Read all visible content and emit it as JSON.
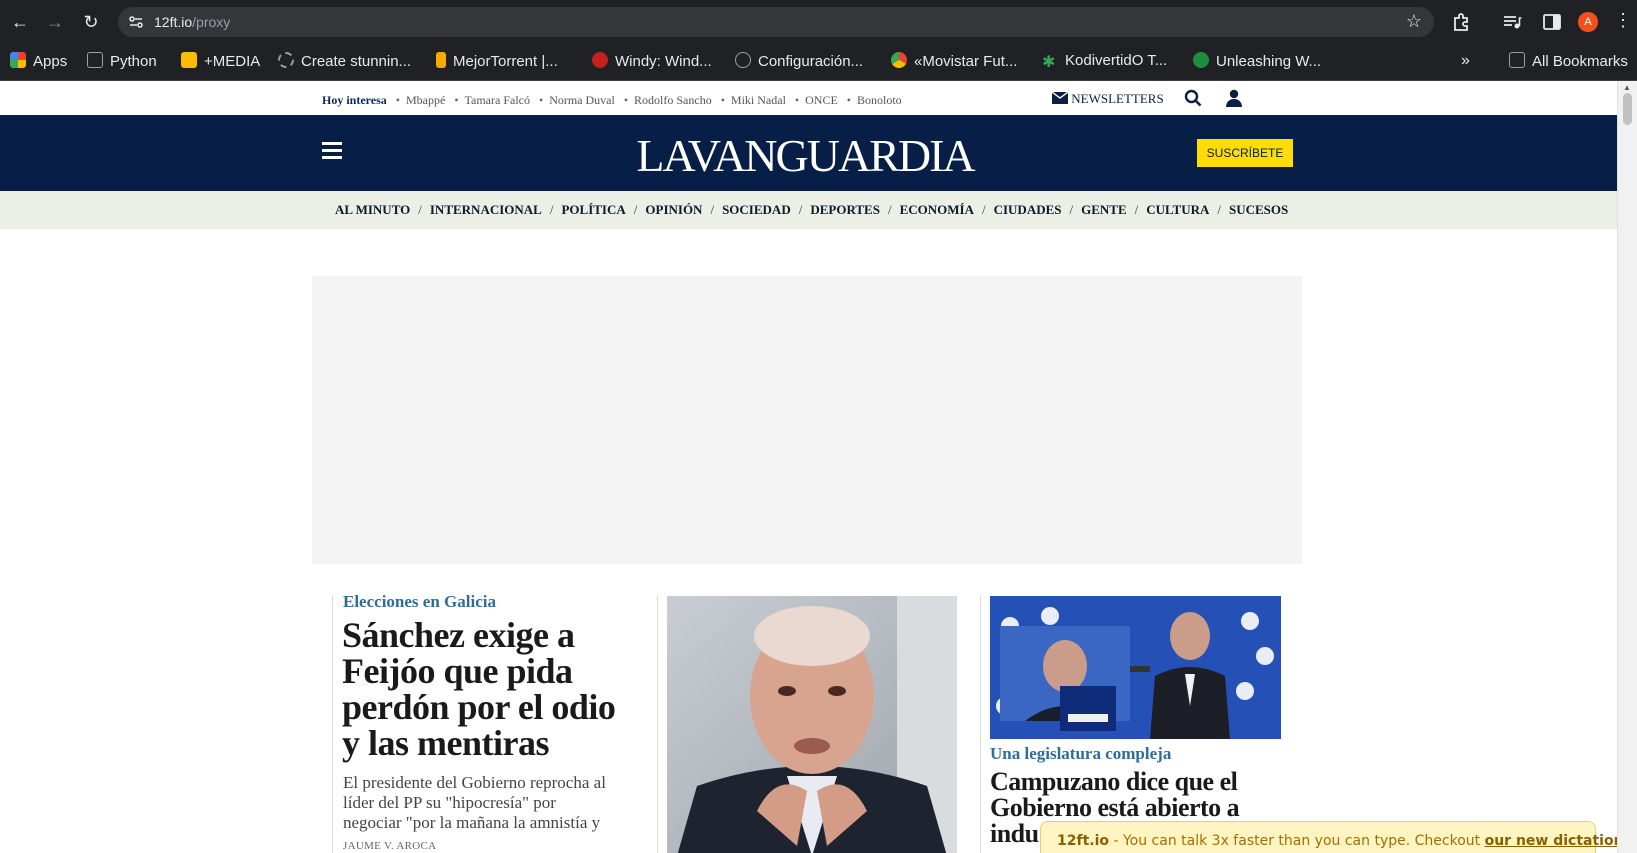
{
  "browser": {
    "url_host": "12ft.io",
    "url_path": "/proxy",
    "avatar_letter": "A",
    "bookmarks": [
      {
        "label": "Apps",
        "icon": "apps-grid-icon",
        "color": "#e8453c"
      },
      {
        "label": "Python",
        "icon": "folder-icon",
        "color": "#9aa0a6"
      },
      {
        "label": "+MEDIA",
        "icon": "plus-media-icon",
        "color": "#fbbc04"
      },
      {
        "label": "Create stunnin...",
        "icon": "spinner-icon",
        "color": "#9aa0a6"
      },
      {
        "label": "MejorTorrent |...",
        "icon": "torrent-icon",
        "color": "#f9ab00"
      },
      {
        "label": "Windy: Wind...",
        "icon": "windy-icon",
        "color": "#c5221f"
      },
      {
        "label": "Configuración...",
        "icon": "gear-globe-icon",
        "color": "#9aa0a6"
      },
      {
        "label": "«Movistar Fut...",
        "icon": "chrome-icon",
        "color": "#34a853"
      },
      {
        "label": "KodivertidO T...",
        "icon": "kodi-star-icon",
        "color": "#34a853"
      },
      {
        "label": "Unleashing W...",
        "icon": "leaf-icon",
        "color": "#1e8e3e"
      }
    ],
    "all_bookmarks": "All Bookmarks"
  },
  "site": {
    "hoy_label": "Hoy interesa",
    "trending": [
      "Mbappé",
      "Tamara Falcó",
      "Norma Duval",
      "Rodolfo Sancho",
      "Miki Nadal",
      "ONCE",
      "Bonoloto"
    ],
    "newsletters": "NEWSLETTERS",
    "logo": "LAVANGUARDIA",
    "subscribe": "SUSCRÍBETE",
    "sections": [
      "AL MINUTO",
      "INTERNACIONAL",
      "POLÍTICA",
      "OPINIÓN",
      "SOCIEDAD",
      "DEPORTES",
      "ECONOMÍA",
      "CIUDADES",
      "GENTE",
      "CULTURA",
      "SUCESOS"
    ],
    "colors": {
      "masthead": "#071e46",
      "subscribe": "#ffdd00",
      "kicker": "#2f6c9a"
    }
  },
  "articles": {
    "main": {
      "kicker": "Elecciones en Galicia",
      "headline_lines": [
        "Sánchez exige a",
        "Feijóo que pida",
        "perdón por el odio",
        "y las mentiras"
      ],
      "summary_lines": [
        "El presidente del Gobierno reprocha al",
        "líder del PP su \"hipocresía\" por",
        "negociar \"por la mañana la amnistía y"
      ],
      "byline": "JAUME V. AROCA"
    },
    "third": {
      "kicker": "Una legislatura compleja",
      "headline_lines": [
        "Campuzano dice que el",
        "Gobierno está abierto a",
        "indu"
      ]
    }
  },
  "notice": {
    "brand": "12ft.io",
    "text": " - You can talk 3x faster than you can type. Checkout ",
    "link": "our new dictation app."
  }
}
